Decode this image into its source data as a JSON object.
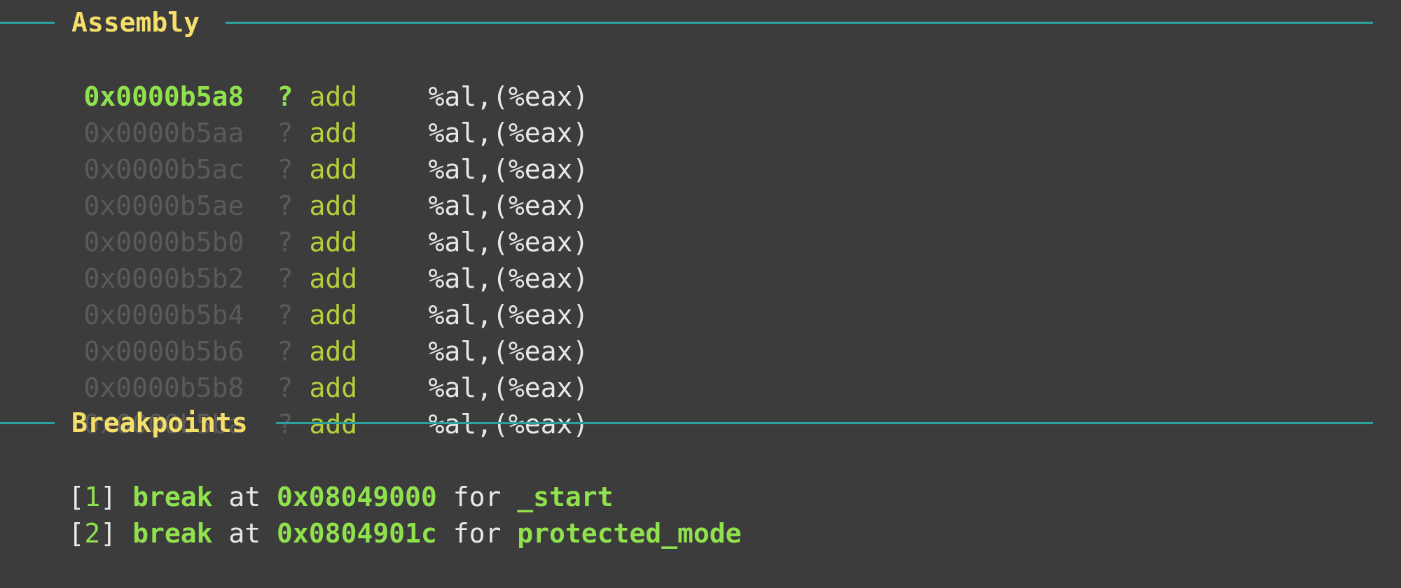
{
  "assembly": {
    "header": "Assembly",
    "rows": [
      {
        "addr": "0x0000b5a8",
        "marker": "?",
        "mnemonic": "add",
        "operands": "%al,(%eax)"
      },
      {
        "addr": "0x0000b5aa",
        "marker": "?",
        "mnemonic": "add",
        "operands": "%al,(%eax)"
      },
      {
        "addr": "0x0000b5ac",
        "marker": "?",
        "mnemonic": "add",
        "operands": "%al,(%eax)"
      },
      {
        "addr": "0x0000b5ae",
        "marker": "?",
        "mnemonic": "add",
        "operands": "%al,(%eax)"
      },
      {
        "addr": "0x0000b5b0",
        "marker": "?",
        "mnemonic": "add",
        "operands": "%al,(%eax)"
      },
      {
        "addr": "0x0000b5b2",
        "marker": "?",
        "mnemonic": "add",
        "operands": "%al,(%eax)"
      },
      {
        "addr": "0x0000b5b4",
        "marker": "?",
        "mnemonic": "add",
        "operands": "%al,(%eax)"
      },
      {
        "addr": "0x0000b5b6",
        "marker": "?",
        "mnemonic": "add",
        "operands": "%al,(%eax)"
      },
      {
        "addr": "0x0000b5b8",
        "marker": "?",
        "mnemonic": "add",
        "operands": "%al,(%eax)"
      },
      {
        "addr": "0x0000b5ba",
        "marker": "?",
        "mnemonic": "add",
        "operands": "%al,(%eax)"
      }
    ]
  },
  "breakpoints": {
    "header": "Breakpoints",
    "items": [
      {
        "lbr": "[",
        "num": "1",
        "rbr": "]",
        "kw": "break",
        "at": "at",
        "addr": "0x08049000",
        "for": "for",
        "sym": "_start"
      },
      {
        "lbr": "[",
        "num": "2",
        "rbr": "]",
        "kw": "break",
        "at": "at",
        "addr": "0x0804901c",
        "for": "for",
        "sym": "protected_mode"
      }
    ]
  },
  "colors": {
    "background": "#3c3c3c",
    "rule": "#2aa3a0",
    "header_text": "#f5df6a",
    "current_address": "#8fe24d",
    "dim_address": "#5a5a5a",
    "mnemonic": "#b8cf3a",
    "text": "#e8e8e8"
  }
}
